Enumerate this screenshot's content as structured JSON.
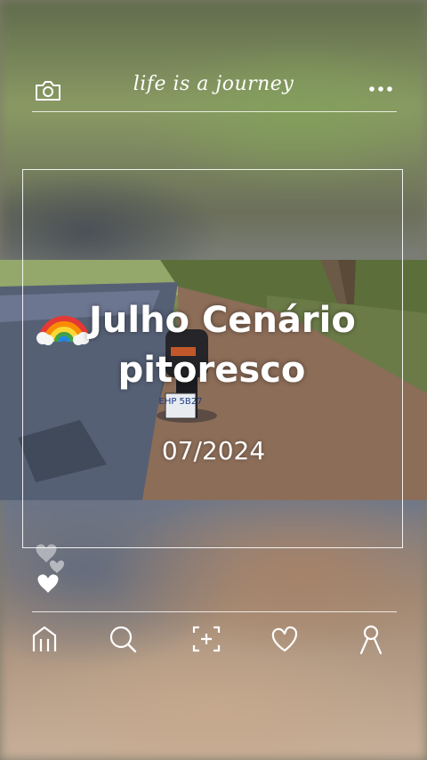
{
  "header": {
    "title": "life is a journey",
    "left_icon": "camera-icon",
    "right_icon": "more-options-icon"
  },
  "post": {
    "caption_line1": "Julho Cenário",
    "caption_line2": "pitoresco",
    "caption_icon": "rainbow-emoji",
    "date": "07/2024",
    "license_plate": "EHP 5B27"
  },
  "reaction_icon": "hearts-icon",
  "bottom_nav": {
    "items": [
      "home-icon",
      "search-icon",
      "add-photo-icon",
      "heart-icon",
      "profile-icon"
    ]
  },
  "colors": {
    "line": "#ffffff",
    "text": "#ffffff"
  }
}
